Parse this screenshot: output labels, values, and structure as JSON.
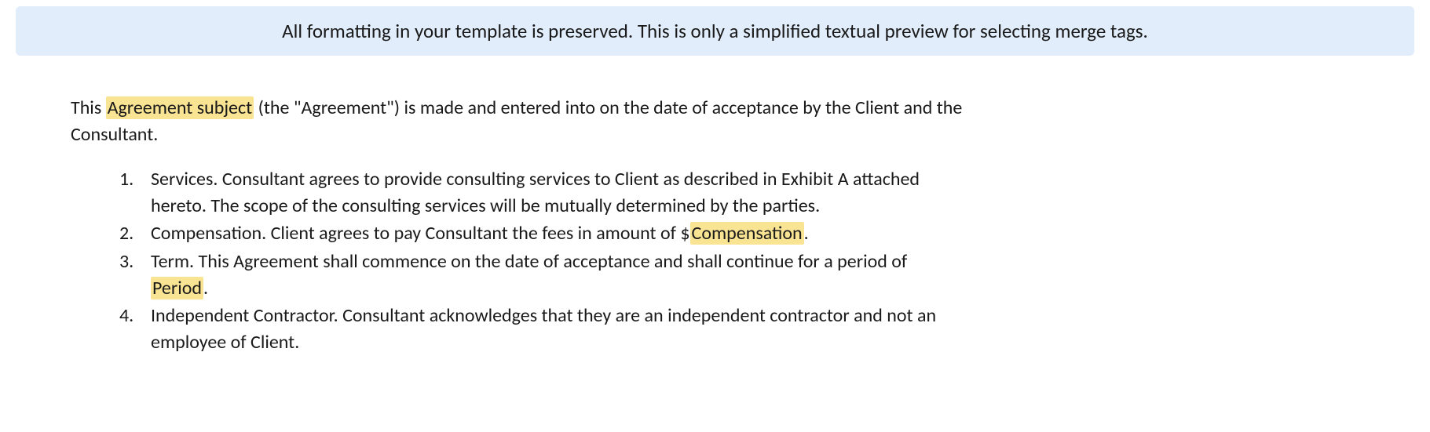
{
  "banner": {
    "text": "All formatting in your template is preserved. This is only a simplified textual preview for selecting merge tags."
  },
  "intro": {
    "prefix": "This ",
    "tag1": "Agreement subject",
    "suffix": " (the \"Agreement\") is made and entered into on the date of acceptance by the Client and the Consultant."
  },
  "items": {
    "item1": {
      "number": "1.",
      "text": "Services. Consultant agrees to provide consulting services to Client as described in Exhibit A attached hereto. The scope of the consulting services will be mutually determined by the parties."
    },
    "item2": {
      "number": "2.",
      "prefix": "Compensation. Client agrees to pay Consultant the fees in amount of $",
      "tag": "Compensation",
      "suffix": "."
    },
    "item3": {
      "number": "3.",
      "prefix": "Term. This Agreement shall commence on the date of acceptance and shall continue for a period of ",
      "tag": "Period",
      "suffix": "."
    },
    "item4": {
      "number": "4.",
      "text": "Independent Contractor. Consultant acknowledges that they are an independent contractor and not an employee of Client."
    }
  }
}
